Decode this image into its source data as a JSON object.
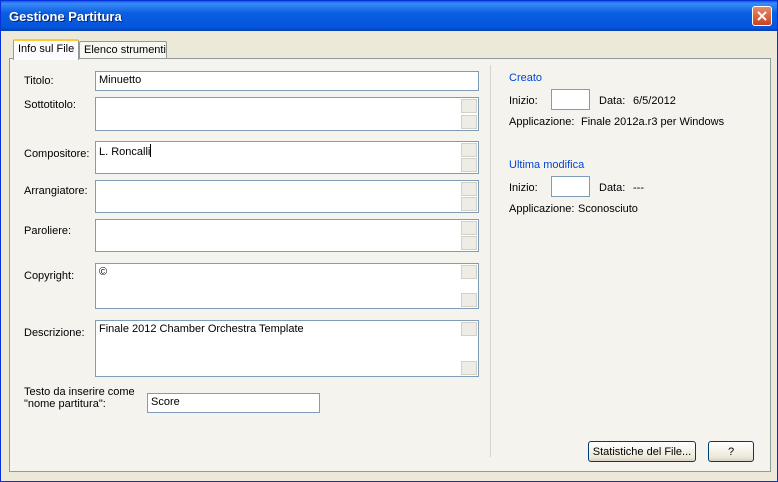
{
  "window": {
    "title": "Gestione Partitura"
  },
  "tabs": [
    {
      "label": "Info sul File"
    },
    {
      "label": "Elenco strumenti"
    }
  ],
  "info": {
    "titolo": {
      "label": "Titolo:",
      "value": "Minuetto"
    },
    "sottotitolo": {
      "label": "Sottotitolo:",
      "value": ""
    },
    "compositore": {
      "label": "Compositore:",
      "value": "L. Roncalli"
    },
    "arrangiatore": {
      "label": "Arrangiatore:",
      "value": ""
    },
    "paroliere": {
      "label": "Paroliere:",
      "value": ""
    },
    "copyright": {
      "label": "Copyright:",
      "value": "©"
    },
    "descrizione": {
      "label": "Descrizione:",
      "value": "Finale 2012 Chamber Orchestra Template"
    },
    "testo": {
      "label_line1": "Testo da inserire come",
      "label_line2": "\"nome partitura\":",
      "value": "Score"
    }
  },
  "creato": {
    "heading": "Creato",
    "inizio_label": "Inizio:",
    "inizio_value": "",
    "data_label": "Data:",
    "data_value": "6/5/2012",
    "app_label": "Applicazione:",
    "app_value": "Finale 2012a.r3 per Windows"
  },
  "ultima": {
    "heading": "Ultima modifica",
    "inizio_label": "Inizio:",
    "inizio_value": "",
    "data_label": "Data:",
    "data_value": "---",
    "app_label": "Applicazione:",
    "app_value": "Sconosciuto"
  },
  "buttons": {
    "stats": "Statistiche del File...",
    "help": "?"
  },
  "colors": {
    "titlebar": "#0a5ee0",
    "section_heading": "#0046d5",
    "dialog_bg": "#ece9d8"
  },
  "icons": {
    "close": "close-icon"
  }
}
